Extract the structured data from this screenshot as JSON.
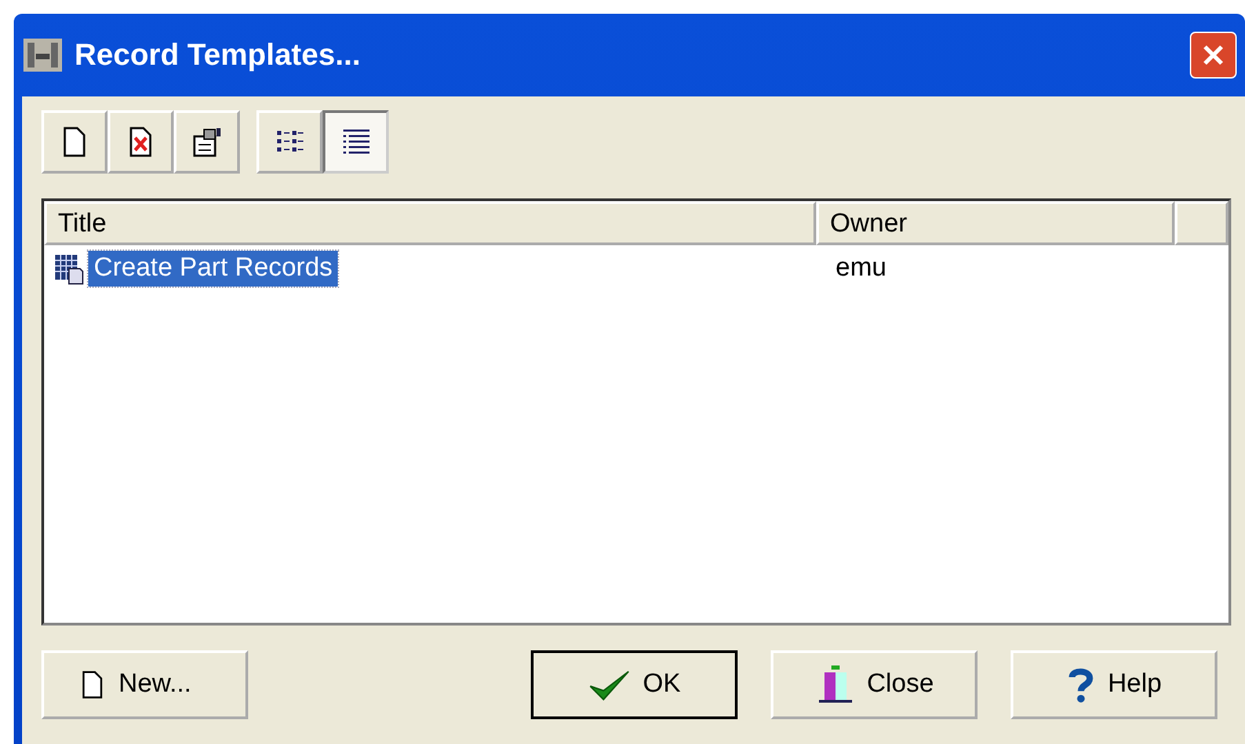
{
  "window": {
    "title": "Record Templates..."
  },
  "toolbar": [
    {
      "kind": "new"
    },
    {
      "kind": "delete"
    },
    {
      "kind": "properties"
    }
  ],
  "view_toggles": [
    {
      "kind": "list",
      "selected": false
    },
    {
      "kind": "details",
      "selected": true
    }
  ],
  "table": {
    "columns": [
      "Title",
      "Owner"
    ],
    "rows": [
      {
        "title": "Create Part Records",
        "owner": "emu",
        "selected": true
      }
    ]
  },
  "buttons": [
    {
      "kind": "new",
      "label": "New..."
    },
    {
      "kind": "ok",
      "label": "OK"
    },
    {
      "kind": "close",
      "label": "Close"
    },
    {
      "kind": "help",
      "label": "Help"
    }
  ]
}
